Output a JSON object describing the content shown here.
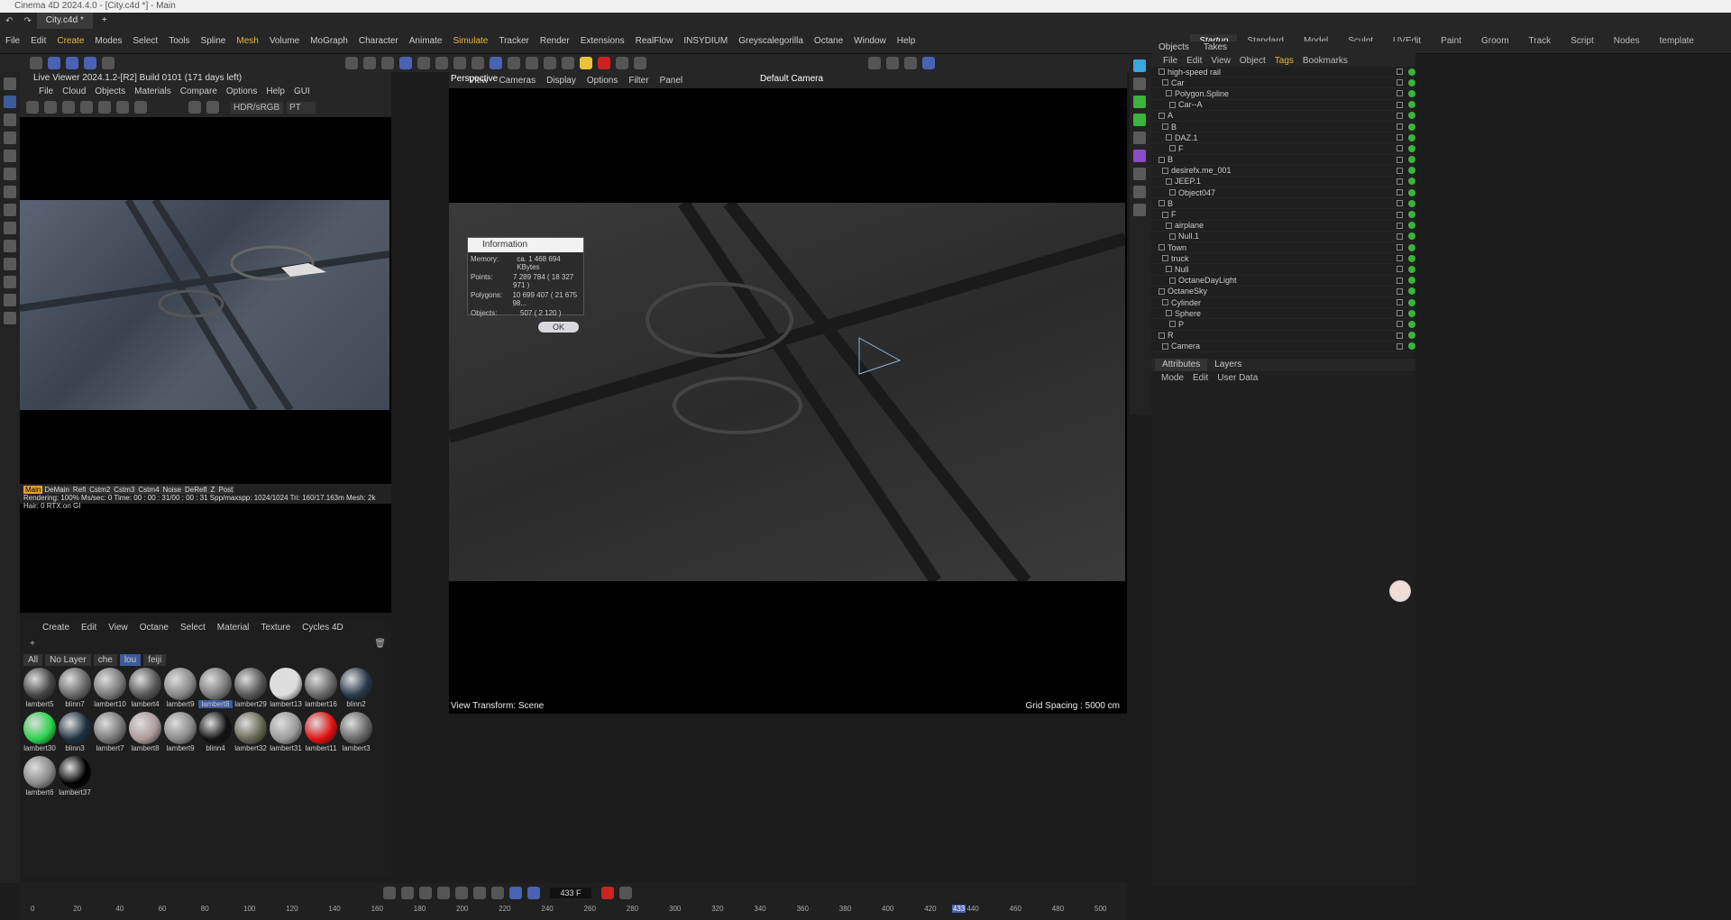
{
  "window": {
    "title": "Cinema 4D 2024.4.0 - [City.c4d *] - Main"
  },
  "tabs": [
    {
      "label": "City.c4d *"
    },
    {
      "label": "+"
    }
  ],
  "menus": [
    "File",
    "Edit",
    "Create",
    "Modes",
    "Select",
    "Tools",
    "Spline",
    "Mesh",
    "Volume",
    "MoGraph",
    "Character",
    "Animate",
    "Simulate",
    "Tracker",
    "Render",
    "Extensions",
    "RealFlow",
    "INSYDIUM",
    "Greyscalegorilla",
    "Octane",
    "Window",
    "Help"
  ],
  "layouts": [
    "Startup",
    "Standard",
    "Model",
    "Sculpt",
    "UVEdit",
    "Paint",
    "Groom",
    "Track",
    "Script",
    "Nodes",
    "template"
  ],
  "live_viewer": {
    "title": "Live Viewer 2024.1.2-[R2] Build 0101 (171 days left)",
    "menu": [
      "File",
      "Cloud",
      "Objects",
      "Materials",
      "Compare",
      "Options",
      "Help",
      "GUI"
    ],
    "color_space": "HDR/sRGB",
    "mode": "PT",
    "status_tabs": [
      "Main",
      "DeMain",
      "Refl",
      "Cstm2",
      "Cstm3",
      "Cstm4",
      "Noise",
      "DeRefl",
      "Z",
      "Post"
    ],
    "status": "Rendering: 100%   Ms/sec: 0   Time: 00 : 00 : 31/00 : 00 : 31   Spp/maxspp: 1024/1024  Tri: 160/17.163m   Mesh: 2k   Hair: 0   RTX:on   GI"
  },
  "materials": {
    "menu": [
      "Create",
      "Edit",
      "View",
      "Octane",
      "Select",
      "Material",
      "Texture",
      "Cycles 4D"
    ],
    "layers": [
      "All",
      "No Layer",
      "che",
      "lou",
      "feiji"
    ],
    "items": [
      {
        "name": "lambert5",
        "color": "#444"
      },
      {
        "name": "blinn7",
        "color": "#666"
      },
      {
        "name": "lambert10",
        "color": "#777"
      },
      {
        "name": "lambert4",
        "color": "#555"
      },
      {
        "name": "lambert9",
        "color": "#888"
      },
      {
        "name": "lambert8",
        "color": "#777"
      },
      {
        "name": "lambert29",
        "color": "#555"
      },
      {
        "name": "lambert13",
        "color": "#ddd"
      },
      {
        "name": "lambert16",
        "color": "#666"
      },
      {
        "name": "blinn2",
        "color": "#2a3848"
      },
      {
        "name": "lambert30",
        "color": "#2bd14a"
      },
      {
        "name": "blinn3",
        "color": "#1e3040"
      },
      {
        "name": "lambert7",
        "color": "#777"
      },
      {
        "name": "lambert8",
        "color": "#a99"
      },
      {
        "name": "lambert9",
        "color": "#888"
      },
      {
        "name": "blinn4",
        "color": "#111"
      },
      {
        "name": "lambert32",
        "color": "#665"
      },
      {
        "name": "lambert31",
        "color": "#999"
      },
      {
        "name": "lambert11",
        "color": "#e01010"
      },
      {
        "name": "lambert3",
        "color": "#666"
      },
      {
        "name": "lambert6",
        "color": "#888"
      },
      {
        "name": "lambert37",
        "color": "#000"
      }
    ]
  },
  "viewport": {
    "menu": [
      "View",
      "Cameras",
      "Display",
      "Options",
      "Filter",
      "Panel"
    ],
    "name": "Perspective",
    "camera": "Default Camera",
    "transform": "View Transform: Scene",
    "grid": "Grid Spacing : 5000 cm"
  },
  "info_dialog": {
    "title": "Information",
    "rows": [
      {
        "k": "Memory:",
        "v": "ca. 1 468 694 KBytes"
      },
      {
        "k": "Points:",
        "v": "7 289 784 ( 18 327 971 )"
      },
      {
        "k": "Polygons:",
        "v": "10 699 407 ( 21 675 98..."
      },
      {
        "k": "Objects:",
        "v": "507 ( 2 120 )"
      }
    ],
    "ok": "OK"
  },
  "objects": {
    "tabs": [
      "Objects",
      "Takes"
    ],
    "menu": [
      "File",
      "Edit",
      "View",
      "Object",
      "Tags",
      "Bookmarks"
    ],
    "rows": [
      "high-speed rail",
      "Car",
      "Polygon.Spline",
      "Car--A",
      "A",
      "B",
      "DAZ.1",
      "F",
      "B",
      "desirefx.me_001",
      "JEEP.1",
      "Object047",
      "B",
      "F",
      "airplane",
      "Null.1",
      "Town",
      "truck",
      "Null",
      "OctaneDayLight",
      "OctaneSky",
      "Cylinder",
      "Sphere",
      "P",
      "R",
      "Camera"
    ]
  },
  "attributes": {
    "tabs": [
      "Attributes",
      "Layers"
    ],
    "menu": [
      "Mode",
      "Edit",
      "User Data"
    ]
  },
  "timeline": {
    "frame": "433 F",
    "ticks": [
      "0",
      "20",
      "40",
      "60",
      "80",
      "100",
      "120",
      "140",
      "160",
      "180",
      "200",
      "220",
      "240",
      "260",
      "280",
      "300",
      "320",
      "340",
      "360",
      "380",
      "400",
      "420",
      "440",
      "460",
      "480",
      "500"
    ],
    "current": "433"
  }
}
